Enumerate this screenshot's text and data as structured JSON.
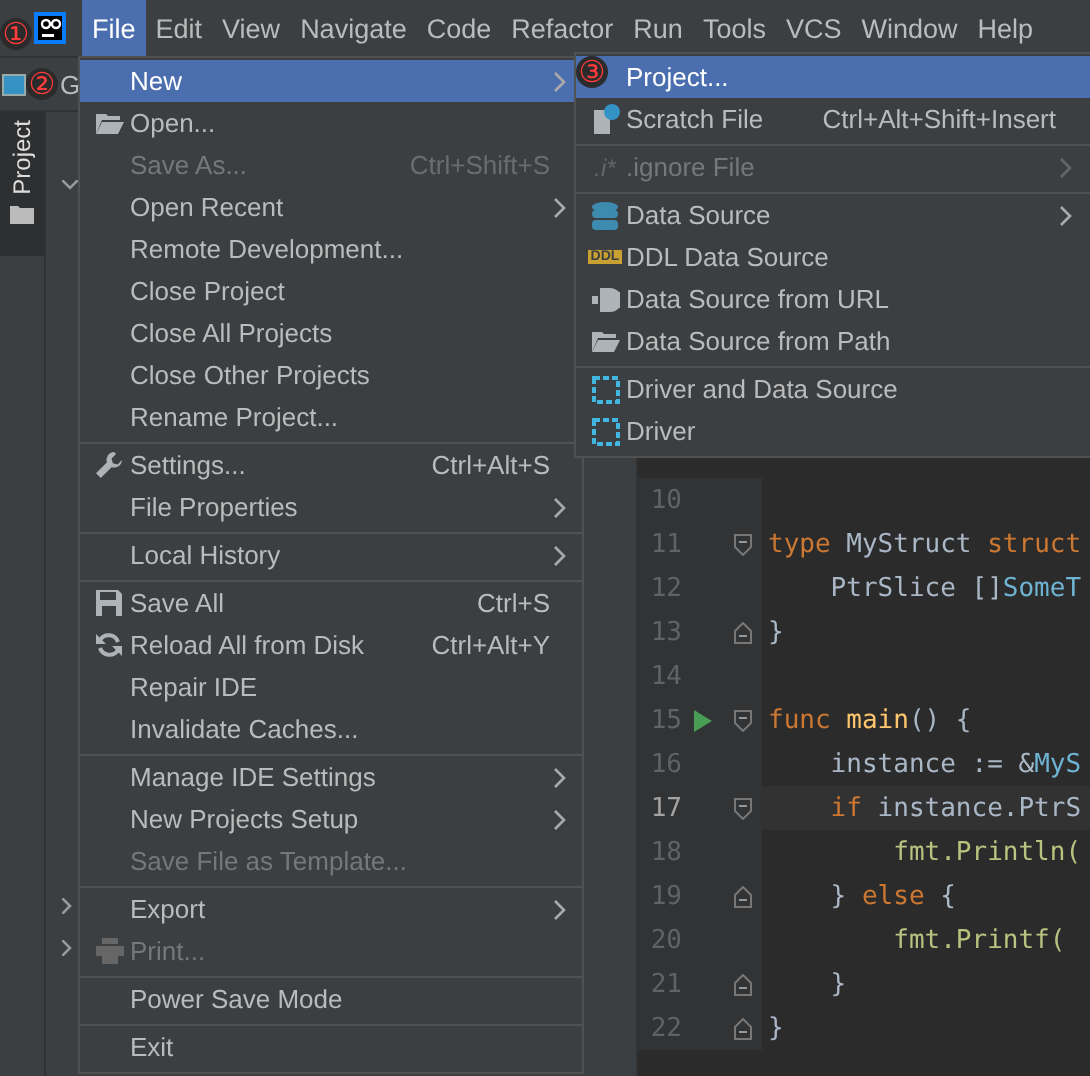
{
  "menu_bar": {
    "items": [
      {
        "label": "File",
        "selected": true
      },
      {
        "label": "Edit",
        "selected": false
      },
      {
        "label": "View",
        "selected": false
      },
      {
        "label": "Navigate",
        "selected": false
      },
      {
        "label": "Code",
        "selected": false
      },
      {
        "label": "Refactor",
        "selected": false
      },
      {
        "label": "Run",
        "selected": false
      },
      {
        "label": "Tools",
        "selected": false
      },
      {
        "label": "VCS",
        "selected": false
      },
      {
        "label": "Window",
        "selected": false
      },
      {
        "label": "Help",
        "selected": false
      }
    ]
  },
  "toolbar": {
    "project_label": "G"
  },
  "tool_strip": {
    "tabs": [
      {
        "label": "Project",
        "selected": true
      }
    ]
  },
  "file_menu": {
    "items": [
      {
        "label": "New",
        "submenu": true,
        "disabled": false,
        "selected": true,
        "separator_before": false
      },
      {
        "label": "Open...",
        "submenu": false,
        "disabled": false,
        "selected": false,
        "separator_before": false
      },
      {
        "label": "Save As...",
        "shortcut": "Ctrl+Shift+S",
        "submenu": false,
        "disabled": true,
        "selected": false,
        "separator_before": false
      },
      {
        "label": "Open Recent",
        "submenu": true,
        "disabled": false,
        "selected": false,
        "separator_before": false
      },
      {
        "label": "Remote Development...",
        "submenu": false,
        "disabled": false,
        "selected": false,
        "separator_before": false
      },
      {
        "label": "Close Project",
        "submenu": false,
        "disabled": false,
        "selected": false,
        "separator_before": false
      },
      {
        "label": "Close All Projects",
        "submenu": false,
        "disabled": false,
        "selected": false,
        "separator_before": false
      },
      {
        "label": "Close Other Projects",
        "submenu": false,
        "disabled": false,
        "selected": false,
        "separator_before": false
      },
      {
        "label": "Rename Project...",
        "submenu": false,
        "disabled": false,
        "selected": false,
        "separator_before": false
      },
      {
        "label": "Settings...",
        "shortcut": "Ctrl+Alt+S",
        "submenu": false,
        "disabled": false,
        "selected": false,
        "separator_before": true
      },
      {
        "label": "File Properties",
        "submenu": true,
        "disabled": false,
        "selected": false,
        "separator_before": false
      },
      {
        "label": "Local History",
        "submenu": true,
        "disabled": false,
        "selected": false,
        "separator_before": true
      },
      {
        "label": "Save All",
        "shortcut": "Ctrl+S",
        "submenu": false,
        "disabled": false,
        "selected": false,
        "separator_before": true
      },
      {
        "label": "Reload All from Disk",
        "shortcut": "Ctrl+Alt+Y",
        "submenu": false,
        "disabled": false,
        "selected": false,
        "separator_before": false
      },
      {
        "label": "Repair IDE",
        "submenu": false,
        "disabled": false,
        "selected": false,
        "separator_before": false
      },
      {
        "label": "Invalidate Caches...",
        "submenu": false,
        "disabled": false,
        "selected": false,
        "separator_before": false
      },
      {
        "label": "Manage IDE Settings",
        "submenu": true,
        "disabled": false,
        "selected": false,
        "separator_before": true
      },
      {
        "label": "New Projects Setup",
        "submenu": true,
        "disabled": false,
        "selected": false,
        "separator_before": false
      },
      {
        "label": "Save File as Template...",
        "submenu": false,
        "disabled": true,
        "selected": false,
        "separator_before": false
      },
      {
        "label": "Export",
        "submenu": true,
        "disabled": false,
        "selected": false,
        "separator_before": true
      },
      {
        "label": "Print...",
        "submenu": false,
        "disabled": true,
        "selected": false,
        "separator_before": false
      },
      {
        "label": "Power Save Mode",
        "submenu": false,
        "disabled": false,
        "selected": false,
        "separator_before": true
      },
      {
        "label": "Exit",
        "submenu": false,
        "disabled": false,
        "selected": false,
        "separator_before": true
      }
    ]
  },
  "new_submenu": {
    "items": [
      {
        "label": "Project...",
        "submenu": false,
        "disabled": false,
        "selected": true,
        "separator_before": false
      },
      {
        "label": "Scratch File",
        "shortcut": "Ctrl+Alt+Shift+Insert",
        "submenu": false,
        "disabled": false,
        "selected": false,
        "separator_before": false
      },
      {
        "label": ".ignore File",
        "icon_text": ".i*",
        "submenu": true,
        "disabled": true,
        "selected": false,
        "separator_before": true
      },
      {
        "label": "Data Source",
        "submenu": true,
        "disabled": false,
        "selected": false,
        "separator_before": true
      },
      {
        "label": "DDL Data Source",
        "icon_text": "DDL",
        "submenu": false,
        "disabled": false,
        "selected": false,
        "separator_before": false
      },
      {
        "label": "Data Source from URL",
        "submenu": false,
        "disabled": false,
        "selected": false,
        "separator_before": false
      },
      {
        "label": "Data Source from Path",
        "submenu": false,
        "disabled": false,
        "selected": false,
        "separator_before": false
      },
      {
        "label": "Driver and Data Source",
        "submenu": false,
        "disabled": false,
        "selected": false,
        "separator_before": true
      },
      {
        "label": "Driver",
        "submenu": false,
        "disabled": false,
        "selected": false,
        "separator_before": false
      }
    ]
  },
  "editor": {
    "lines": [
      {
        "number": "10",
        "current": false,
        "run_marker": false,
        "fold_start": false,
        "fold_end": false
      },
      {
        "number": "11",
        "current": false,
        "run_marker": false,
        "fold_start": true,
        "fold_end": false,
        "tokens": [
          {
            "kind": "keyword",
            "text": "type"
          },
          {
            "kind": "plain",
            "text": " MyStruct "
          },
          {
            "kind": "keyword",
            "text": "struct"
          }
        ]
      },
      {
        "number": "12",
        "current": false,
        "run_marker": false,
        "fold_start": false,
        "fold_end": false,
        "tokens": [
          {
            "kind": "plain",
            "text": "    PtrSlice []"
          },
          {
            "kind": "type",
            "text": "SomeT"
          }
        ]
      },
      {
        "number": "13",
        "current": false,
        "run_marker": false,
        "fold_start": false,
        "fold_end": true,
        "tokens": [
          {
            "kind": "plain",
            "text": "}"
          }
        ]
      },
      {
        "number": "14",
        "current": false,
        "run_marker": false,
        "fold_start": false,
        "fold_end": false
      },
      {
        "number": "15",
        "current": false,
        "run_marker": true,
        "fold_start": true,
        "fold_end": false,
        "tokens": [
          {
            "kind": "keyword",
            "text": "func"
          },
          {
            "kind": "function",
            "text": " main"
          },
          {
            "kind": "plain",
            "text": "() {"
          }
        ]
      },
      {
        "number": "16",
        "current": false,
        "run_marker": false,
        "fold_start": false,
        "fold_end": false,
        "tokens": [
          {
            "kind": "plain",
            "text": "    instance := &"
          },
          {
            "kind": "type",
            "text": "MyS"
          }
        ]
      },
      {
        "number": "17",
        "current": true,
        "run_marker": false,
        "fold_start": true,
        "fold_end": false,
        "tokens": [
          {
            "kind": "keyword",
            "text": "    if"
          },
          {
            "kind": "plain",
            "text": " instance.PtrS"
          }
        ]
      },
      {
        "number": "18",
        "current": false,
        "run_marker": false,
        "fold_start": false,
        "fold_end": false,
        "tokens": [
          {
            "kind": "call",
            "text": "        fmt.Println("
          }
        ]
      },
      {
        "number": "19",
        "current": false,
        "run_marker": false,
        "fold_start": false,
        "fold_end": true,
        "tokens": [
          {
            "kind": "plain",
            "text": "    } "
          },
          {
            "kind": "keyword",
            "text": "else"
          },
          {
            "kind": "plain",
            "text": " {"
          }
        ]
      },
      {
        "number": "20",
        "current": false,
        "run_marker": false,
        "fold_start": false,
        "fold_end": false,
        "tokens": [
          {
            "kind": "call",
            "text": "        fmt.Printf("
          }
        ]
      },
      {
        "number": "21",
        "current": false,
        "run_marker": false,
        "fold_start": false,
        "fold_end": true,
        "tokens": [
          {
            "kind": "plain",
            "text": "    }"
          }
        ]
      },
      {
        "number": "22",
        "current": false,
        "run_marker": false,
        "fold_start": false,
        "fold_end": true,
        "tokens": [
          {
            "kind": "plain",
            "text": "}"
          }
        ]
      }
    ]
  },
  "annotations": [
    {
      "text": "①"
    },
    {
      "text": "②"
    },
    {
      "text": "③"
    }
  ]
}
